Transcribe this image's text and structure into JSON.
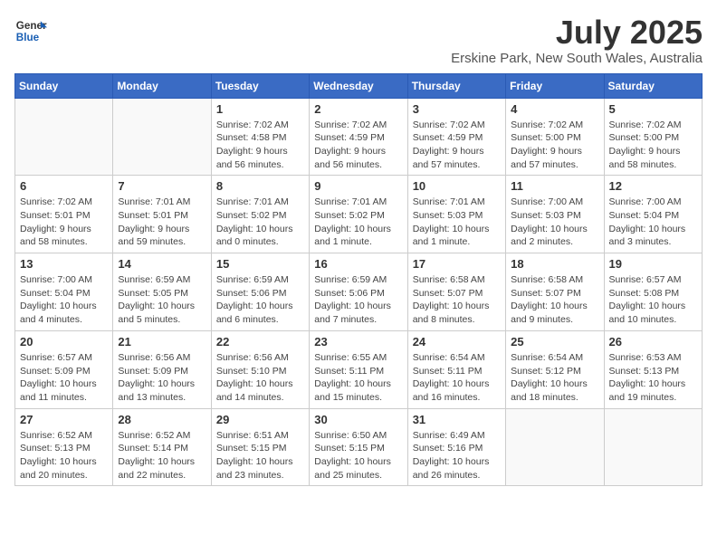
{
  "header": {
    "logo_general": "General",
    "logo_blue": "Blue",
    "month": "July 2025",
    "location": "Erskine Park, New South Wales, Australia"
  },
  "weekdays": [
    "Sunday",
    "Monday",
    "Tuesday",
    "Wednesday",
    "Thursday",
    "Friday",
    "Saturday"
  ],
  "weeks": [
    [
      {
        "day": "",
        "info": ""
      },
      {
        "day": "",
        "info": ""
      },
      {
        "day": "1",
        "info": "Sunrise: 7:02 AM\nSunset: 4:58 PM\nDaylight: 9 hours and 56 minutes."
      },
      {
        "day": "2",
        "info": "Sunrise: 7:02 AM\nSunset: 4:59 PM\nDaylight: 9 hours and 56 minutes."
      },
      {
        "day": "3",
        "info": "Sunrise: 7:02 AM\nSunset: 4:59 PM\nDaylight: 9 hours and 57 minutes."
      },
      {
        "day": "4",
        "info": "Sunrise: 7:02 AM\nSunset: 5:00 PM\nDaylight: 9 hours and 57 minutes."
      },
      {
        "day": "5",
        "info": "Sunrise: 7:02 AM\nSunset: 5:00 PM\nDaylight: 9 hours and 58 minutes."
      }
    ],
    [
      {
        "day": "6",
        "info": "Sunrise: 7:02 AM\nSunset: 5:01 PM\nDaylight: 9 hours and 58 minutes."
      },
      {
        "day": "7",
        "info": "Sunrise: 7:01 AM\nSunset: 5:01 PM\nDaylight: 9 hours and 59 minutes."
      },
      {
        "day": "8",
        "info": "Sunrise: 7:01 AM\nSunset: 5:02 PM\nDaylight: 10 hours and 0 minutes."
      },
      {
        "day": "9",
        "info": "Sunrise: 7:01 AM\nSunset: 5:02 PM\nDaylight: 10 hours and 1 minute."
      },
      {
        "day": "10",
        "info": "Sunrise: 7:01 AM\nSunset: 5:03 PM\nDaylight: 10 hours and 1 minute."
      },
      {
        "day": "11",
        "info": "Sunrise: 7:00 AM\nSunset: 5:03 PM\nDaylight: 10 hours and 2 minutes."
      },
      {
        "day": "12",
        "info": "Sunrise: 7:00 AM\nSunset: 5:04 PM\nDaylight: 10 hours and 3 minutes."
      }
    ],
    [
      {
        "day": "13",
        "info": "Sunrise: 7:00 AM\nSunset: 5:04 PM\nDaylight: 10 hours and 4 minutes."
      },
      {
        "day": "14",
        "info": "Sunrise: 6:59 AM\nSunset: 5:05 PM\nDaylight: 10 hours and 5 minutes."
      },
      {
        "day": "15",
        "info": "Sunrise: 6:59 AM\nSunset: 5:06 PM\nDaylight: 10 hours and 6 minutes."
      },
      {
        "day": "16",
        "info": "Sunrise: 6:59 AM\nSunset: 5:06 PM\nDaylight: 10 hours and 7 minutes."
      },
      {
        "day": "17",
        "info": "Sunrise: 6:58 AM\nSunset: 5:07 PM\nDaylight: 10 hours and 8 minutes."
      },
      {
        "day": "18",
        "info": "Sunrise: 6:58 AM\nSunset: 5:07 PM\nDaylight: 10 hours and 9 minutes."
      },
      {
        "day": "19",
        "info": "Sunrise: 6:57 AM\nSunset: 5:08 PM\nDaylight: 10 hours and 10 minutes."
      }
    ],
    [
      {
        "day": "20",
        "info": "Sunrise: 6:57 AM\nSunset: 5:09 PM\nDaylight: 10 hours and 11 minutes."
      },
      {
        "day": "21",
        "info": "Sunrise: 6:56 AM\nSunset: 5:09 PM\nDaylight: 10 hours and 13 minutes."
      },
      {
        "day": "22",
        "info": "Sunrise: 6:56 AM\nSunset: 5:10 PM\nDaylight: 10 hours and 14 minutes."
      },
      {
        "day": "23",
        "info": "Sunrise: 6:55 AM\nSunset: 5:11 PM\nDaylight: 10 hours and 15 minutes."
      },
      {
        "day": "24",
        "info": "Sunrise: 6:54 AM\nSunset: 5:11 PM\nDaylight: 10 hours and 16 minutes."
      },
      {
        "day": "25",
        "info": "Sunrise: 6:54 AM\nSunset: 5:12 PM\nDaylight: 10 hours and 18 minutes."
      },
      {
        "day": "26",
        "info": "Sunrise: 6:53 AM\nSunset: 5:13 PM\nDaylight: 10 hours and 19 minutes."
      }
    ],
    [
      {
        "day": "27",
        "info": "Sunrise: 6:52 AM\nSunset: 5:13 PM\nDaylight: 10 hours and 20 minutes."
      },
      {
        "day": "28",
        "info": "Sunrise: 6:52 AM\nSunset: 5:14 PM\nDaylight: 10 hours and 22 minutes."
      },
      {
        "day": "29",
        "info": "Sunrise: 6:51 AM\nSunset: 5:15 PM\nDaylight: 10 hours and 23 minutes."
      },
      {
        "day": "30",
        "info": "Sunrise: 6:50 AM\nSunset: 5:15 PM\nDaylight: 10 hours and 25 minutes."
      },
      {
        "day": "31",
        "info": "Sunrise: 6:49 AM\nSunset: 5:16 PM\nDaylight: 10 hours and 26 minutes."
      },
      {
        "day": "",
        "info": ""
      },
      {
        "day": "",
        "info": ""
      }
    ]
  ]
}
